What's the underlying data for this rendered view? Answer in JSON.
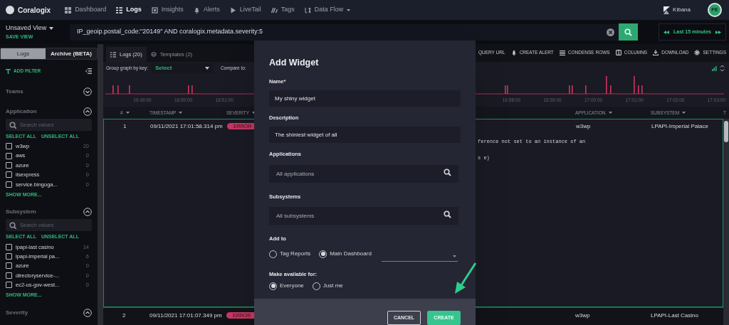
{
  "nav": {
    "brand": "Coralogix",
    "items": [
      {
        "label": "Dashboard",
        "selected": false
      },
      {
        "label": "Logs",
        "selected": true
      },
      {
        "label": "Insights",
        "selected": false
      },
      {
        "label": "Alerts",
        "selected": false
      },
      {
        "label": "LiveTail",
        "selected": false
      },
      {
        "label": "Tags",
        "selected": false
      },
      {
        "label": "Data Flow",
        "selected": false
      }
    ],
    "kibana": "Kibana",
    "avatar": "PE"
  },
  "view": {
    "name": "Unsaved View",
    "save": "SAVE VIEW"
  },
  "query": {
    "value": "IP_geoip.postal_code:\"20149\" AND coralogix.metadata.severity:5"
  },
  "time_range": "Last 15 minutes",
  "sidebar": {
    "tabs": [
      {
        "label": "Logs",
        "selected": true
      },
      {
        "label": "Archive (BETA)",
        "selected": false
      }
    ],
    "add_filter": "ADD FILTER",
    "sections": [
      {
        "title": "Teams",
        "expanded": false
      },
      {
        "title": "Application",
        "expanded": true,
        "search_placeholder": "Search values",
        "select_all": "SELECT ALL",
        "unselect_all": "UNSELECT ALL",
        "show_more": "SHOW MORE...",
        "items": [
          {
            "label": "w3wp",
            "count": "20",
            "checked": false
          },
          {
            "label": "aws",
            "count": "0",
            "checked": false
          },
          {
            "label": "azure",
            "count": "0",
            "checked": false
          },
          {
            "label": "iisexpress",
            "count": "0",
            "checked": false
          },
          {
            "label": "service.bingoga...",
            "count": "0",
            "checked": false
          }
        ]
      },
      {
        "title": "Subsystem",
        "expanded": true,
        "search_placeholder": "Search values",
        "select_all": "SELECT ALL",
        "unselect_all": "UNSELECT ALL",
        "show_more": "SHOW MORE...",
        "items": [
          {
            "label": "lpapi-last casino",
            "count": "14",
            "checked": false
          },
          {
            "label": "lpapi-imperial pa...",
            "count": "6",
            "checked": false
          },
          {
            "label": "azure",
            "count": "0",
            "checked": false
          },
          {
            "label": "directoryservice-...",
            "count": "0",
            "checked": false
          },
          {
            "label": "ec2-us-gov-west...",
            "count": "0",
            "checked": false
          }
        ]
      },
      {
        "title": "Severity",
        "expanded": true
      }
    ]
  },
  "main_tabs": [
    {
      "label": "Logs (20)",
      "selected": true
    },
    {
      "label": "Templates (2)",
      "selected": false
    }
  ],
  "toolbar": [
    "QUERY URL",
    "CREATE ALERT",
    "CONDENSE ROWS",
    "COLUMNS",
    "DOWNLOAD",
    "SETTINGS"
  ],
  "graph": {
    "group_label": "Group graph by key:",
    "group_value": "Select",
    "compare_label": "Compare to:",
    "time_labels": [
      "16:49:00",
      "16:50:00",
      "16:51:00",
      "16:58:00",
      "16:59:00",
      "17:00:00",
      "17:01:00",
      "17:02:00",
      "17:03:00"
    ]
  },
  "table": {
    "columns": [
      "#",
      "TIMESTAMP",
      "SEVERITY",
      "APPLICATION",
      "SUBSYSTEM",
      "T"
    ],
    "rows": [
      {
        "number": "1",
        "timestamp": "09/11/2021 17:01:58.314 pm",
        "severity": "ERROR",
        "application": "w3wp",
        "subsystem": "LPAPI-Imperial Palace",
        "message_lines": [
          "ference not set to an instance of an",
          "s e)"
        ],
        "selected": true
      },
      {
        "number": "2",
        "timestamp": "09/11/2021 17:01:07.349 pm",
        "severity": "ERROR",
        "application": "w3wp",
        "subsystem": "LPAPI-Last Casino",
        "selected": false
      }
    ]
  },
  "dialog": {
    "title": "Add Widget",
    "fields": [
      {
        "label": "Name*",
        "value": "My shiny widget",
        "kind": "text"
      },
      {
        "label": "Description",
        "value": "The shiniest widget of all",
        "kind": "text"
      },
      {
        "label": "Applications",
        "placeholder": "All applications",
        "kind": "search"
      },
      {
        "label": "Subsystems",
        "placeholder": "All subsystems",
        "kind": "search"
      }
    ],
    "add_to": {
      "label": "Add to",
      "options": [
        {
          "label": "Tag Reports",
          "selected": false
        },
        {
          "label": "Main Dashboard",
          "selected": true
        }
      ]
    },
    "available_for": {
      "label": "Make available for:",
      "options": [
        {
          "label": "Everyone",
          "selected": true
        },
        {
          "label": "Just me",
          "selected": false
        }
      ]
    },
    "buttons": [
      {
        "label": "CANCEL",
        "kind": "secondary"
      },
      {
        "label": "CREATE",
        "kind": "primary"
      }
    ]
  }
}
